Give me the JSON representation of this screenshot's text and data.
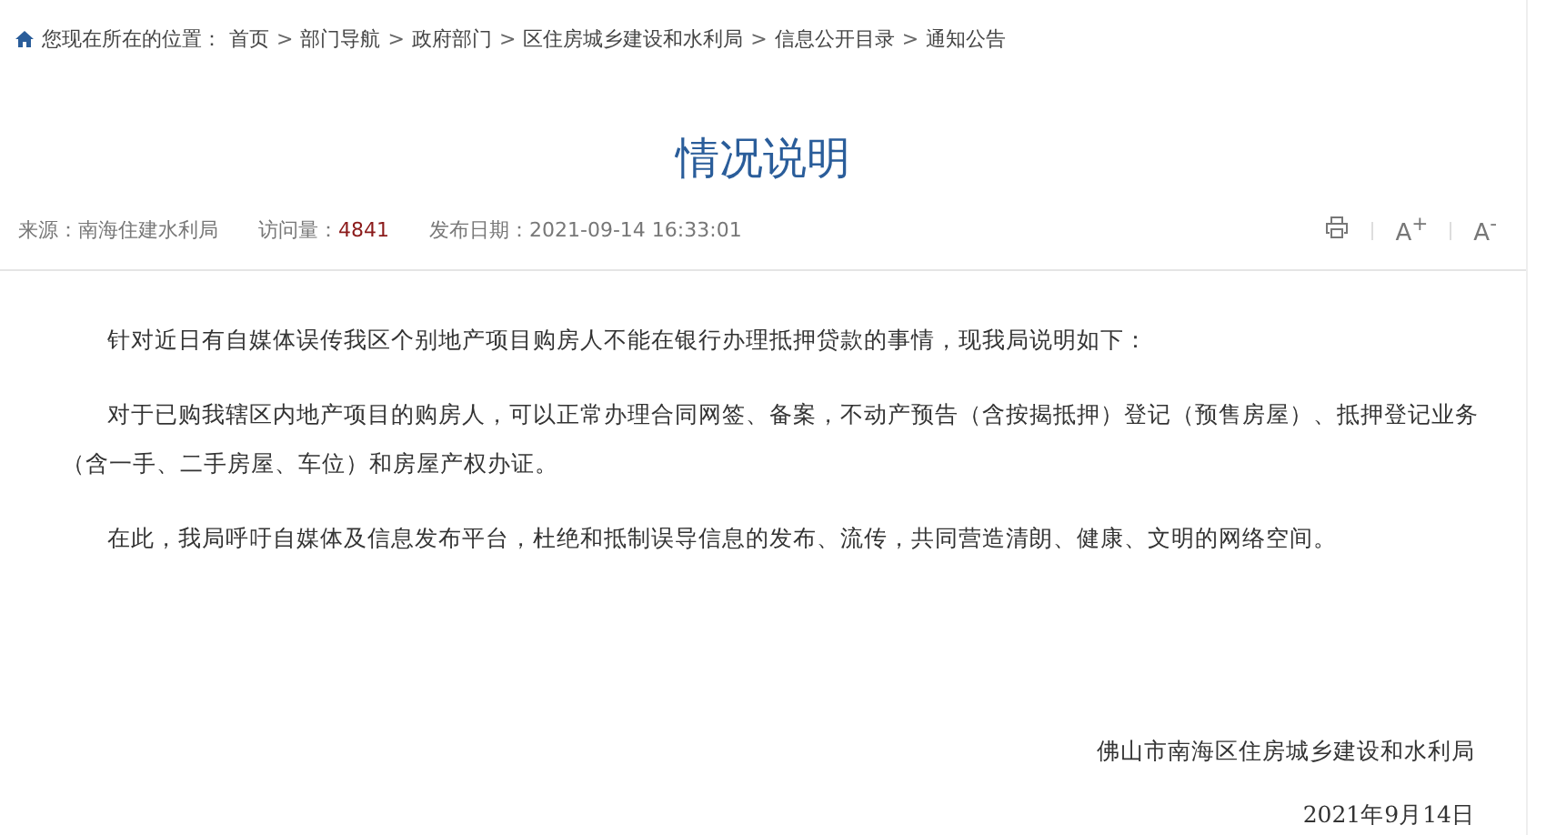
{
  "breadcrumb": {
    "prefix": "您现在所在的位置：",
    "separator": ">",
    "items": [
      "首页",
      "部门导航",
      "政府部门",
      "区住房城乡建设和水利局",
      "信息公开目录",
      "通知公告"
    ]
  },
  "article": {
    "title": "情况说明",
    "meta": [
      {
        "label": "来源：",
        "value": "南海住建水利局",
        "highlight": false
      },
      {
        "label": "访问量：",
        "value": "4841",
        "highlight": true
      },
      {
        "label": "发布日期：",
        "value": "2021-09-14 16:33:01",
        "highlight": false
      }
    ],
    "tools": [
      {
        "kind": "print"
      },
      {
        "kind": "text",
        "label": "A$^{+}$"
      },
      {
        "kind": "text",
        "label": "A$^{-}$"
      }
    ],
    "paragraphs": [
      "针对近日有自媒体误传我区个别地产项目购房人不能在银行办理抵押贷款的事情，现我局说明如下：",
      "对于已购我辖区内地产项目的购房人，可以正常办理合同网签、备案，不动产预告（含按揭抵押）登记（预售房屋）、抵押登记业务（含一手、二手房屋、车位）和房屋产权办证。",
      "在此，我局呼吁自媒体及信息发布平台，杜绝和抵制误导信息的发布、流传，共同营造清朗、健康、文明的网络空间。"
    ],
    "signature": "佛山市南海区住房城乡建设和水利局",
    "date": "2021年9月14日"
  }
}
